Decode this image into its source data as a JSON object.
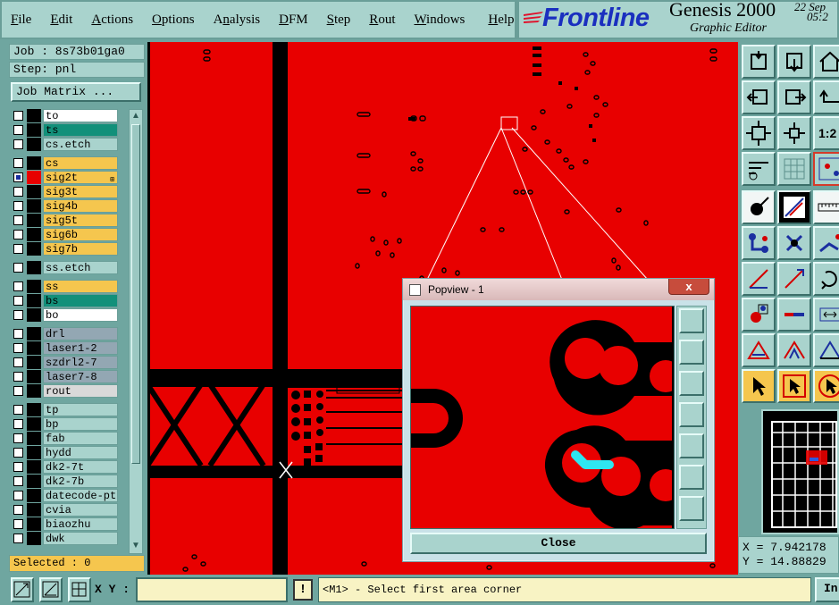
{
  "menubar": {
    "items": [
      {
        "label": "File",
        "key": "F"
      },
      {
        "label": "Edit",
        "key": "E"
      },
      {
        "label": "Actions",
        "key": "A"
      },
      {
        "label": "Options",
        "key": "O"
      },
      {
        "label": "Analysis",
        "key": "n"
      },
      {
        "label": "DFM",
        "key": "D"
      },
      {
        "label": "Step",
        "key": "S"
      },
      {
        "label": "Rout",
        "key": "R"
      },
      {
        "label": "Windows",
        "key": "W"
      },
      {
        "label": "Help",
        "key": "H"
      }
    ]
  },
  "brand": {
    "logo": "Frontline",
    "product": "Genesis 2000",
    "subtitle": "Graphic Editor",
    "date": "22 Sep",
    "time": "05:2"
  },
  "left": {
    "job": "Job : 8s73b01ga0",
    "step": "Step: pnl",
    "job_matrix": "Job Matrix ...",
    "selected": "Selected : 0",
    "layers": [
      {
        "name": "to",
        "color": "#ffffff",
        "checked": false,
        "affected": false
      },
      {
        "name": "ts",
        "color": "#12907a",
        "checked": false,
        "affected": false
      },
      {
        "name": "cs.etch",
        "color": "#a9d3cd",
        "checked": false,
        "affected": false
      },
      {
        "name": "cs",
        "color": "#f5c64e",
        "checked": false,
        "affected": false
      },
      {
        "name": "sig2t",
        "color": "#f5c64e",
        "checked": true,
        "affected": true
      },
      {
        "name": "sig3t",
        "color": "#f5c64e",
        "checked": false,
        "affected": false
      },
      {
        "name": "sig4b",
        "color": "#f5c64e",
        "checked": false,
        "affected": false
      },
      {
        "name": "sig5t",
        "color": "#f5c64e",
        "checked": false,
        "affected": false
      },
      {
        "name": "sig6b",
        "color": "#f5c64e",
        "checked": false,
        "affected": false
      },
      {
        "name": "sig7b",
        "color": "#f5c64e",
        "checked": false,
        "affected": false
      },
      {
        "name": "ss.etch",
        "color": "#a9d3cd",
        "checked": false,
        "affected": false
      },
      {
        "name": "ss",
        "color": "#f5c64e",
        "checked": false,
        "affected": false
      },
      {
        "name": "bs",
        "color": "#12907a",
        "checked": false,
        "affected": false
      },
      {
        "name": "bo",
        "color": "#ffffff",
        "checked": false,
        "affected": false
      },
      {
        "name": "drl",
        "color": "#93a7b3",
        "checked": false,
        "affected": false
      },
      {
        "name": "laser1-2",
        "color": "#93a7b3",
        "checked": false,
        "affected": false
      },
      {
        "name": "szdrl2-7",
        "color": "#93a7b3",
        "checked": false,
        "affected": false
      },
      {
        "name": "laser7-8",
        "color": "#93a7b3",
        "checked": false,
        "affected": false
      },
      {
        "name": "rout",
        "color": "#d9d9d9",
        "checked": false,
        "affected": false
      },
      {
        "name": "tp",
        "color": "#a9d3cd",
        "checked": false,
        "affected": false
      },
      {
        "name": "bp",
        "color": "#a9d3cd",
        "checked": false,
        "affected": false
      },
      {
        "name": "fab",
        "color": "#a9d3cd",
        "checked": false,
        "affected": false
      },
      {
        "name": "hydd",
        "color": "#a9d3cd",
        "checked": false,
        "affected": false
      },
      {
        "name": "dk2-7t",
        "color": "#a9d3cd",
        "checked": false,
        "affected": false
      },
      {
        "name": "dk2-7b",
        "color": "#a9d3cd",
        "checked": false,
        "affected": false
      },
      {
        "name": "datecode-pt",
        "color": "#a9d3cd",
        "checked": false,
        "affected": false
      },
      {
        "name": "cvia",
        "color": "#a9d3cd",
        "checked": false,
        "affected": false
      },
      {
        "name": "biaozhu",
        "color": "#a9d3cd",
        "checked": false,
        "affected": false
      },
      {
        "name": "dwk",
        "color": "#a9d3cd",
        "checked": false,
        "affected": false
      }
    ]
  },
  "popview": {
    "title": "Popview - 1",
    "close_label": "Close",
    "close_x": "x"
  },
  "coords": {
    "x": "X = 7.942178",
    "y": "Y = 14.88829"
  },
  "bottom": {
    "xy_label": "X Y :",
    "xy_value": "",
    "bang": "!",
    "status": "<M1> - Select first area corner",
    "in_label": "In"
  },
  "colors": {
    "board": "#e80000",
    "panel": "#a9d3cd",
    "affected_layer": "#e80000",
    "highlight": "#2ee6f0"
  }
}
